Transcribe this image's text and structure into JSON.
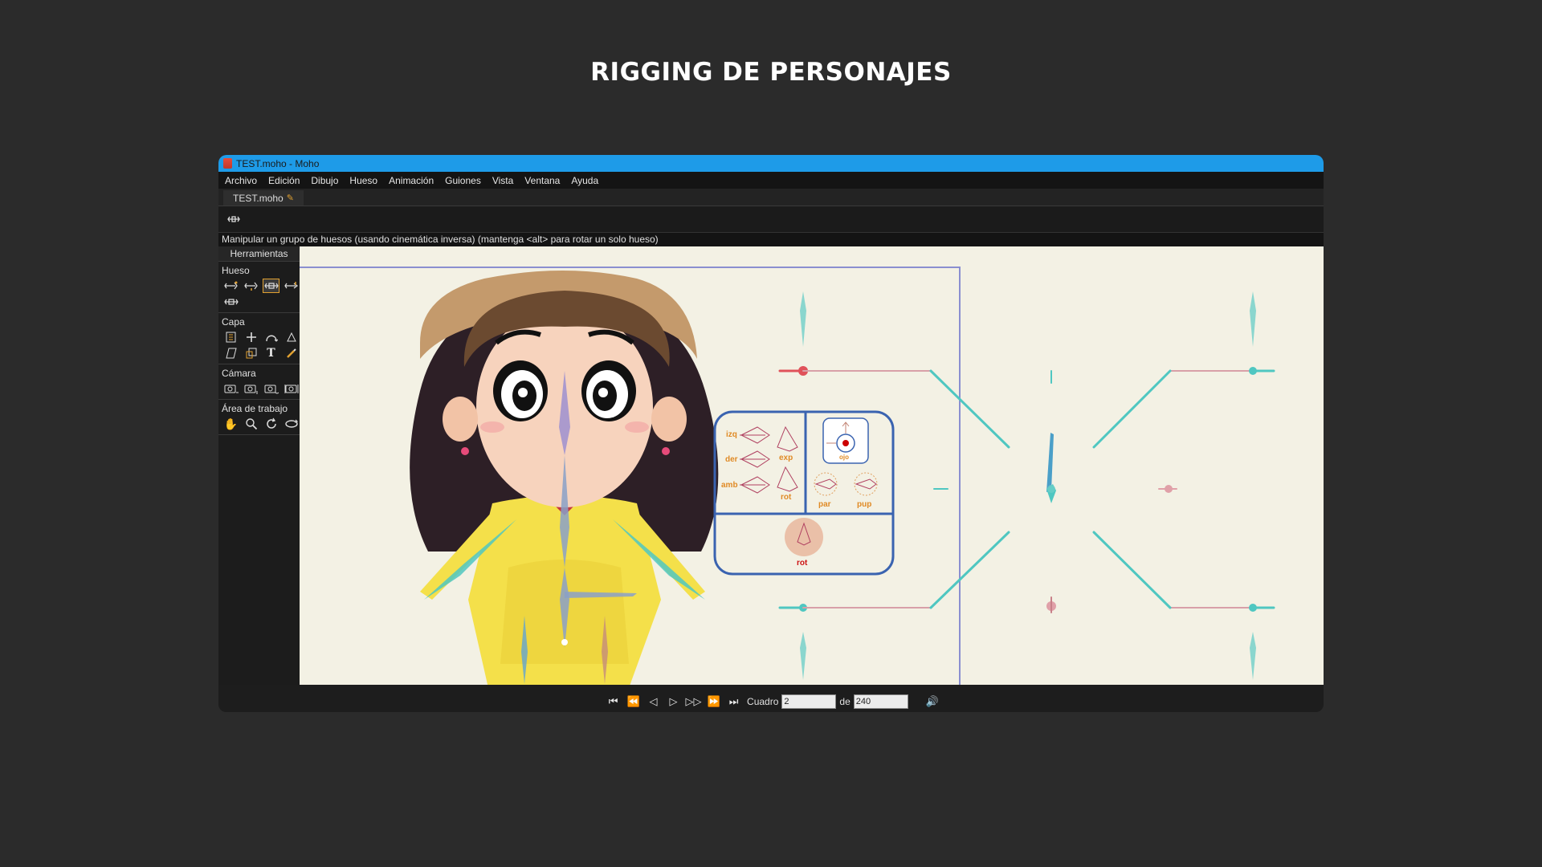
{
  "page": {
    "title": "RIGGING DE PERSONAJES"
  },
  "window": {
    "title": "TEST.moho - Moho"
  },
  "menu": [
    "Archivo",
    "Edición",
    "Dibujo",
    "Hueso",
    "Animación",
    "Guiones",
    "Vista",
    "Ventana",
    "Ayuda"
  ],
  "document_tab": {
    "label": "TEST.moho",
    "modified_icon": "pencil-icon"
  },
  "status": {
    "text": "Manipular un grupo de huesos (usando cinemática inversa) (mantenga <alt> para rotar un solo hueso)"
  },
  "tools_panel": {
    "tab_label": "Herramientas",
    "sections": [
      {
        "label": "Hueso",
        "tools": [
          "select-bone-icon",
          "translate-bone-icon",
          "manipulate-bones-icon",
          "add-bone-icon",
          "reparent-bone-icon"
        ],
        "active_index": 2
      },
      {
        "label": "Capa",
        "tools": [
          "transform-layer-icon",
          "set-origin-icon",
          "follow-path-icon",
          "rotate-layer-icon",
          "shear-layer-icon",
          "scale-layer-icon",
          "text-icon",
          "eyedropper-icon"
        ]
      },
      {
        "label": "Cámara",
        "tools": [
          "track-camera-icon",
          "zoom-camera-icon",
          "roll-camera-icon",
          "pan-tilt-camera-icon"
        ]
      },
      {
        "label": "Área de trabajo",
        "tools": [
          "hand-icon",
          "magnifier-icon",
          "rotate-workspace-icon",
          "orbit-workspace-icon"
        ]
      }
    ]
  },
  "controller_panel": {
    "labels": {
      "izq": "izq",
      "der": "der",
      "amb": "amb",
      "exp": "exp",
      "rot_top": "rot",
      "ojo": "ojo",
      "par": "par",
      "pup": "pup",
      "rot_bottom": "rot"
    }
  },
  "playback": {
    "frame_label": "Cuadro",
    "frame_value": "2",
    "of_label": "de",
    "total_value": "240"
  },
  "colors": {
    "background": "#2b2b2b",
    "titlebar": "#1e9be8",
    "canvas": "#f3f1e4",
    "active_tool_border": "#e0a030",
    "bone_cyan": "#4fc7c1",
    "bone_red": "#e0525a",
    "controller_frame": "#3a63b0"
  }
}
